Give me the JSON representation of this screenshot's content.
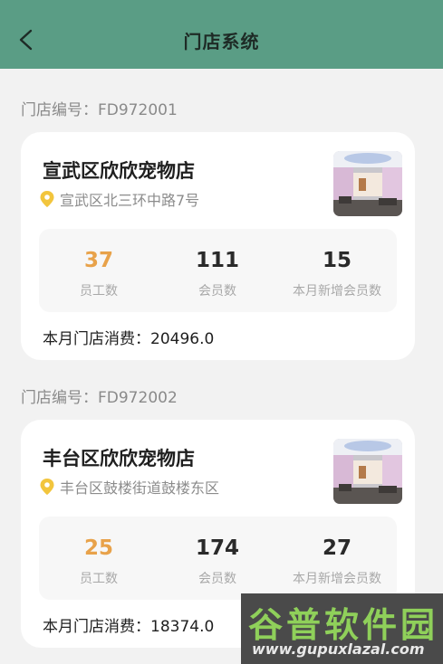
{
  "header": {
    "title": "门店系统"
  },
  "stores": [
    {
      "store_no": "门店编号：FD972001",
      "name": "宣武区欣欣宠物店",
      "address": "宣武区北三环中路7号",
      "stats": [
        {
          "value": "37",
          "label": "员工数"
        },
        {
          "value": "111",
          "label": "会员数"
        },
        {
          "value": "15",
          "label": "本月新增会员数"
        }
      ],
      "consumption": "本月门店消费：20496.0"
    },
    {
      "store_no": "门店编号：FD972002",
      "name": "丰台区欣欣宠物店",
      "address": "丰台区鼓楼街道鼓楼东区",
      "stats": [
        {
          "value": "25",
          "label": "员工数"
        },
        {
          "value": "174",
          "label": "会员数"
        },
        {
          "value": "27",
          "label": "本月新增会员数"
        }
      ],
      "consumption": "本月门店消费：18374.0"
    }
  ],
  "watermark": {
    "cn": "谷普软件园",
    "en": "www.gupuxlazal.com"
  },
  "colors": {
    "header": "#5a9d85",
    "accent_orange": "#e8a24a",
    "pin": "#f2c53d"
  }
}
